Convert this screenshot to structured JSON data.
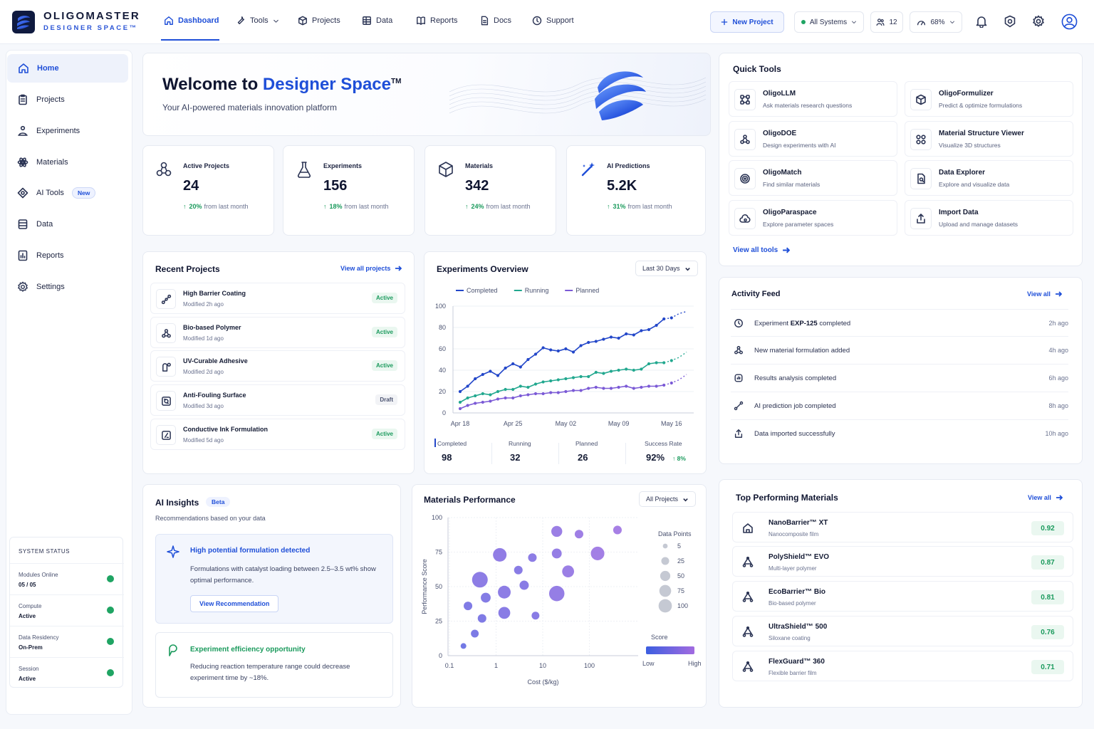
{
  "brand": {
    "name": "OLIGOMASTER",
    "sub": "DESIGNER SPACE™"
  },
  "nav": [
    {
      "label": "Dashboard",
      "icon": "home-icon"
    },
    {
      "label": "Tools",
      "icon": "tools-icon"
    },
    {
      "label": "Projects",
      "icon": "cube-icon"
    },
    {
      "label": "Data",
      "icon": "grid-icon"
    },
    {
      "label": "Reports",
      "icon": "book-icon"
    },
    {
      "label": "Docs",
      "icon": "document-icon"
    },
    {
      "label": "Support",
      "icon": "help-icon"
    }
  ],
  "header": {
    "new_project": "New Project",
    "systems": "All Systems",
    "users_count": "12",
    "perf": "68%"
  },
  "sidebar": {
    "items": [
      {
        "label": "Home"
      },
      {
        "label": "Projects"
      },
      {
        "label": "Experiments"
      },
      {
        "label": "Materials"
      },
      {
        "label": "AI Tools",
        "badge": "New"
      },
      {
        "label": "Data"
      },
      {
        "label": "Reports"
      },
      {
        "label": "Settings"
      }
    ],
    "system_status": {
      "title": "SYSTEM STATUS",
      "rows": [
        {
          "label": "Modules Online",
          "value": "05 / 05"
        },
        {
          "label": "Compute",
          "value": "Active"
        },
        {
          "label": "Data Residency",
          "value": "On-Prem"
        },
        {
          "label": "Session",
          "value": "Active"
        }
      ]
    }
  },
  "hero": {
    "title_pre": "Welcome to ",
    "title_accent": "Designer Space",
    "tm": "TM",
    "subtitle": "Your AI-powered materials innovation platform"
  },
  "stats": [
    {
      "label": "Active Projects",
      "value": "24",
      "change": "20%",
      "suffix": "from last month"
    },
    {
      "label": "Experiments",
      "value": "156",
      "change": "18%",
      "suffix": "from last month"
    },
    {
      "label": "Materials",
      "value": "342",
      "change": "24%",
      "suffix": "from last month"
    },
    {
      "label": "AI Predictions",
      "value": "5.2K",
      "change": "31%",
      "suffix": "from last month"
    }
  ],
  "recent_projects": {
    "title": "Recent Projects",
    "view_all": "View all projects",
    "items": [
      {
        "name": "High Barrier Coating",
        "meta": "Modified 2h ago",
        "status": "Active"
      },
      {
        "name": "Bio-based Polymer",
        "meta": "Modified 1d ago",
        "status": "Active"
      },
      {
        "name": "UV-Curable Adhesive",
        "meta": "Modified 2d ago",
        "status": "Active"
      },
      {
        "name": "Anti-Fouling Surface",
        "meta": "Modified 3d ago",
        "status": "Draft"
      },
      {
        "name": "Conductive Ink Formulation",
        "meta": "Modified 5d ago",
        "status": "Active"
      }
    ]
  },
  "experiments_overview": {
    "title": "Experiments Overview",
    "range": "Last 30 Days",
    "summary": [
      {
        "label": "Completed",
        "value": "98"
      },
      {
        "label": "Running",
        "value": "32"
      },
      {
        "label": "Planned",
        "value": "26"
      },
      {
        "label": "Success Rate",
        "value": "92%",
        "delta": "↑ 8%"
      }
    ]
  },
  "quick_tools": {
    "title": "Quick Tools",
    "view_all": "View all tools",
    "items": [
      {
        "name": "OligoLLM",
        "desc": "Ask materials research questions"
      },
      {
        "name": "OligoFormulizer",
        "desc": "Predict & optimize formulations"
      },
      {
        "name": "OligoDOE",
        "desc": "Design experiments with AI"
      },
      {
        "name": "Material Structure Viewer",
        "desc": "Visualize 3D structures"
      },
      {
        "name": "OligoMatch",
        "desc": "Find similar materials"
      },
      {
        "name": "Data Explorer",
        "desc": "Explore and visualize data"
      },
      {
        "name": "OligoParaspace",
        "desc": "Explore parameter spaces"
      },
      {
        "name": "Import Data",
        "desc": "Upload and manage datasets"
      }
    ]
  },
  "activity": {
    "title": "Activity Feed",
    "view_all": "View all",
    "items": [
      {
        "pre": "Experiment ",
        "bold": "EXP-125",
        "post": " completed",
        "ago": "2h ago"
      },
      {
        "pre": "New material formulation added",
        "bold": "",
        "post": "",
        "ago": "4h ago"
      },
      {
        "pre": "Results analysis completed",
        "bold": "",
        "post": "",
        "ago": "6h ago"
      },
      {
        "pre": "AI prediction job completed",
        "bold": "",
        "post": "",
        "ago": "8h ago"
      },
      {
        "pre": "Data imported successfully",
        "bold": "",
        "post": "",
        "ago": "10h ago"
      }
    ]
  },
  "ai_insights": {
    "title": "AI Insights",
    "badge": "Beta",
    "subtitle": "Recommendations based on your data",
    "cards": [
      {
        "title": "High potential formulation detected",
        "body": "Formulations with catalyst loading between 2.5–3.5 wt% show optimal performance.",
        "button": "View Recommendation"
      },
      {
        "title": "Experiment efficiency opportunity",
        "body": "Reducing reaction temperature range could decrease experiment time by ~18%."
      }
    ]
  },
  "materials_performance": {
    "title": "Materials Performance",
    "filter": "All Projects"
  },
  "top_materials": {
    "title": "Top Performing Materials",
    "view_all": "View all",
    "items": [
      {
        "name": "NanoBarrier™ XT",
        "desc": "Nanocomposite film",
        "score": "0.92"
      },
      {
        "name": "PolyShield™ EVO",
        "desc": "Multi-layer polymer",
        "score": "0.87"
      },
      {
        "name": "EcoBarrier™ Bio",
        "desc": "Bio-based polymer",
        "score": "0.81"
      },
      {
        "name": "UltraShield™ 500",
        "desc": "Siloxane coating",
        "score": "0.76"
      },
      {
        "name": "FlexGuard™ 360",
        "desc": "Flexible barrier film",
        "score": "0.71"
      }
    ]
  },
  "colors": {
    "accent": "#1f4fd8",
    "completed": "#2347c9",
    "running": "#22a88f",
    "planned": "#7b5ad6",
    "success": "#1a9a5c"
  },
  "chart_data": [
    {
      "type": "line",
      "title": "Experiments Overview",
      "x": [
        "Apr 18",
        "Apr 19",
        "Apr 20",
        "Apr 21",
        "Apr 22",
        "Apr 23",
        "Apr 24",
        "Apr 25",
        "Apr 26",
        "Apr 27",
        "Apr 28",
        "Apr 29",
        "Apr 30",
        "May 01",
        "May 02",
        "May 03",
        "May 04",
        "May 05",
        "May 06",
        "May 07",
        "May 08",
        "May 09",
        "May 10",
        "May 11",
        "May 12",
        "May 13",
        "May 14",
        "May 15",
        "May 16",
        "May 17",
        "May 18"
      ],
      "x_ticks": [
        "Apr 18",
        "Apr 25",
        "May 02",
        "May 09",
        "May 16"
      ],
      "ylim": [
        0,
        100
      ],
      "y_ticks": [
        0,
        20,
        40,
        60,
        80,
        100
      ],
      "legend": "top-left",
      "grid": true,
      "series": [
        {
          "name": "Completed",
          "values": [
            20,
            25,
            32,
            36,
            39,
            35,
            42,
            46,
            43,
            50,
            55,
            61,
            59,
            58,
            60,
            57,
            63,
            66,
            67,
            69,
            71,
            70,
            74,
            73,
            77,
            78,
            82,
            88,
            89,
            93,
            95
          ]
        },
        {
          "name": "Running",
          "values": [
            10,
            14,
            16,
            18,
            17,
            20,
            22,
            22,
            25,
            24,
            27,
            29,
            30,
            31,
            32,
            33,
            34,
            34,
            38,
            37,
            39,
            40,
            41,
            40,
            41,
            46,
            47,
            47,
            49,
            52,
            57
          ]
        },
        {
          "name": "Planned",
          "values": [
            4,
            7,
            9,
            10,
            11,
            13,
            14,
            14,
            16,
            17,
            18,
            18,
            19,
            19,
            20,
            21,
            21,
            23,
            24,
            23,
            23,
            24,
            25,
            23,
            24,
            25,
            25,
            26,
            28,
            31,
            36
          ]
        }
      ],
      "forecast_from_index": 27
    },
    {
      "type": "scatter",
      "title": "Materials Performance",
      "xlabel": "Cost ($/kg)",
      "ylabel": "Performance Score",
      "x_scale": "log",
      "xlim": [
        0.1,
        1000
      ],
      "ylim": [
        0,
        100
      ],
      "x_ticks": [
        "0.1",
        "1",
        "10",
        "100"
      ],
      "y_ticks": [
        0,
        25,
        50,
        75,
        100
      ],
      "legend_title": "Data Points",
      "size_legend": [
        5,
        25,
        50,
        75,
        100
      ],
      "colorbar": {
        "title": "Score",
        "low": "Low",
        "high": "High"
      },
      "points": [
        {
          "x": 0.2,
          "y": 7,
          "size": 5,
          "score": 0.3
        },
        {
          "x": 0.35,
          "y": 16,
          "size": 15,
          "score": 0.4
        },
        {
          "x": 0.25,
          "y": 36,
          "size": 20,
          "score": 0.45
        },
        {
          "x": 0.5,
          "y": 27,
          "size": 20,
          "score": 0.45
        },
        {
          "x": 0.6,
          "y": 42,
          "size": 30,
          "score": 0.5
        },
        {
          "x": 0.45,
          "y": 55,
          "size": 100,
          "score": 0.6
        },
        {
          "x": 1.5,
          "y": 31,
          "size": 50,
          "score": 0.55
        },
        {
          "x": 1.5,
          "y": 46,
          "size": 60,
          "score": 0.6
        },
        {
          "x": 1.2,
          "y": 73,
          "size": 70,
          "score": 0.65
        },
        {
          "x": 3,
          "y": 62,
          "size": 20,
          "score": 0.55
        },
        {
          "x": 4,
          "y": 51,
          "size": 25,
          "score": 0.55
        },
        {
          "x": 6,
          "y": 71,
          "size": 20,
          "score": 0.6
        },
        {
          "x": 7,
          "y": 29,
          "size": 15,
          "score": 0.55
        },
        {
          "x": 20,
          "y": 74,
          "size": 30,
          "score": 0.7
        },
        {
          "x": 20,
          "y": 90,
          "size": 40,
          "score": 0.75
        },
        {
          "x": 20,
          "y": 45,
          "size": 95,
          "score": 0.7
        },
        {
          "x": 35,
          "y": 61,
          "size": 50,
          "score": 0.75
        },
        {
          "x": 60,
          "y": 88,
          "size": 20,
          "score": 0.8
        },
        {
          "x": 150,
          "y": 74,
          "size": 70,
          "score": 0.85
        },
        {
          "x": 400,
          "y": 91,
          "size": 20,
          "score": 0.9
        }
      ]
    }
  ]
}
